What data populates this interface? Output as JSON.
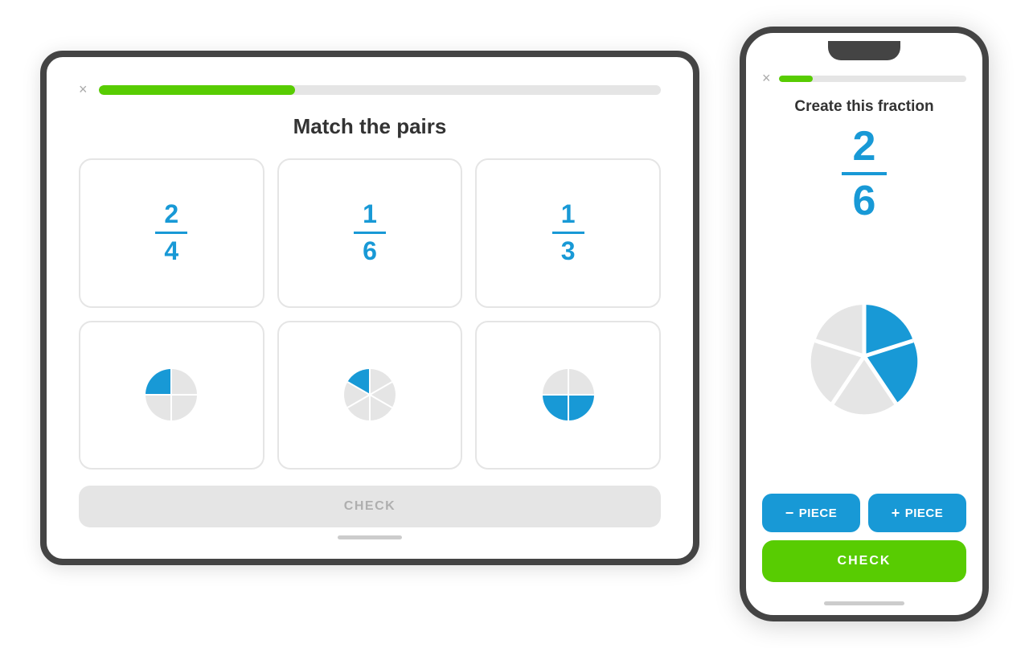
{
  "tablet": {
    "close_label": "×",
    "progress_percent": 35,
    "title": "Match the pairs",
    "check_button_label": "CHECK",
    "fractions": [
      {
        "numerator": "2",
        "denominator": "4"
      },
      {
        "numerator": "1",
        "denominator": "6"
      },
      {
        "numerator": "1",
        "denominator": "3"
      }
    ],
    "pie_charts": [
      {
        "filled_slices": 1,
        "total_slices": 4,
        "label": "quarter pie"
      },
      {
        "filled_slices": 1,
        "total_slices": 6,
        "label": "sixth pie"
      },
      {
        "filled_slices": 2,
        "total_slices": 4,
        "label": "half pie"
      }
    ]
  },
  "phone": {
    "close_label": "×",
    "progress_percent": 18,
    "title": "Create this fraction",
    "fraction": {
      "numerator": "2",
      "denominator": "6"
    },
    "pie": {
      "filled_slices": 2,
      "total_slices": 5,
      "label": "two-fifth pie"
    },
    "minus_button_label": "PIECE",
    "plus_button_label": "PIECE",
    "check_button_label": "CHECK"
  },
  "colors": {
    "green": "#58cc02",
    "blue": "#1899d6",
    "gray_bg": "#e5e5e5",
    "text_dark": "#333333",
    "text_gray": "#afafaf"
  }
}
